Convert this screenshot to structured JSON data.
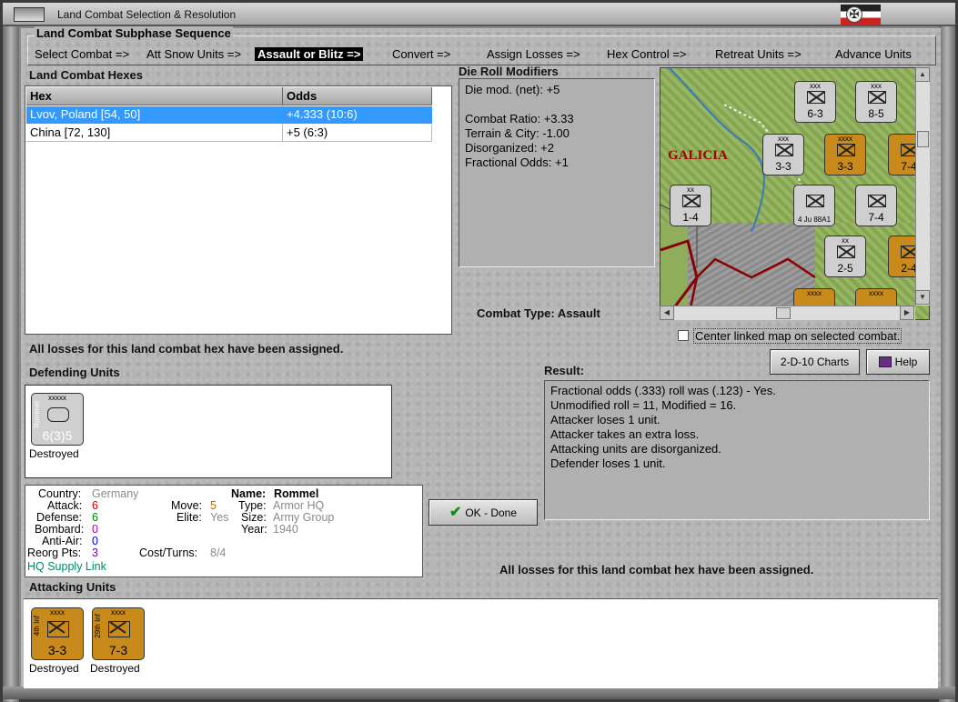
{
  "window": {
    "title": "Land Combat Selection & Resolution"
  },
  "sequence": {
    "title": "Land Combat Subphase Sequence",
    "steps": [
      {
        "label": "Select Combat =>",
        "active": false
      },
      {
        "label": "Att Snow Units =>",
        "active": false
      },
      {
        "label": "Assault or Blitz =>",
        "active": true
      },
      {
        "label": "Convert =>",
        "active": false
      },
      {
        "label": "Assign Losses =>",
        "active": false
      },
      {
        "label": "Hex Control =>",
        "active": false
      },
      {
        "label": "Retreat Units =>",
        "active": false
      },
      {
        "label": "Advance Units",
        "active": false
      }
    ]
  },
  "hexes": {
    "title": "Land Combat Hexes",
    "columns": [
      "Hex",
      "Odds"
    ],
    "rows": [
      {
        "hex": "Lvov, Poland [54, 50]",
        "odds": "+4.333 (10:6)",
        "selected": true
      },
      {
        "hex": "China [72, 130]",
        "odds": "+5 (6:3)",
        "selected": false
      }
    ],
    "losses_note": "All losses for this land combat hex have been assigned."
  },
  "die_roll": {
    "title": "Die Roll Modifiers",
    "lines": [
      "Die mod. (net): +5",
      "",
      "Combat Ratio: +3.33",
      "Terrain & City: -1.00",
      "Disorganized: +2",
      "Fractional Odds: +1"
    ]
  },
  "combat_type": "Combat Type:  Assault",
  "map": {
    "region_label": "GALICIA",
    "counters": [
      {
        "top": "xxx",
        "val": "6-3",
        "color": "grey"
      },
      {
        "top": "xxx",
        "val": "8-5",
        "color": "grey"
      },
      {
        "top": "xxx",
        "val": "3-3",
        "color": "grey"
      },
      {
        "top": "xxxx",
        "val": "3-3",
        "color": "orange"
      },
      {
        "top": "",
        "val": "7-4",
        "color": "orange"
      },
      {
        "top": "xx",
        "val": "1-4",
        "color": "grey"
      },
      {
        "top": "",
        "val": "4 Ju 88A1",
        "color": "grey"
      },
      {
        "top": "",
        "val": "7-4",
        "color": "grey"
      },
      {
        "top": "xx",
        "val": "2-5",
        "color": "grey"
      },
      {
        "top": "",
        "val": "2-4",
        "color": "orange"
      },
      {
        "top": "xxxx",
        "val": "",
        "color": "orange"
      },
      {
        "top": "xxxx",
        "val": "",
        "color": "orange"
      }
    ],
    "center_checkbox_label": "Center linked map on selected combat."
  },
  "buttons": {
    "charts": "2-D-10 Charts",
    "help": "Help",
    "ok": "OK - Done"
  },
  "result": {
    "title": "Result:",
    "lines": [
      "Fractional odds (.333) roll was (.123)  - Yes.",
      "Unmodified roll = 11, Modified = 16.",
      "Attacker loses 1 unit.",
      "Attacker takes an extra loss.",
      "Attacking units are disorganized.",
      "Defender loses 1 unit."
    ],
    "losses_note": "All losses for this land combat hex have been assigned."
  },
  "defending": {
    "title": "Defending Units",
    "units": [
      {
        "top": "xxxxx",
        "side": "Rommel",
        "val": "6(3)5",
        "status": "Destroyed",
        "color": "grey"
      }
    ]
  },
  "unit_info": {
    "country_label": "Country:",
    "country": "Germany",
    "attack_label": "Attack:",
    "attack": "6",
    "defense_label": "Defense:",
    "defense": "6",
    "bombard_label": "Bombard:",
    "bombard": "0",
    "antiair_label": "Anti-Air:",
    "antiair": "0",
    "reorg_label": "Reorg Pts:",
    "reorg": "3",
    "hq_link": "HQ Supply Link",
    "move_label": "Move:",
    "move": "5",
    "elite_label": "Elite:",
    "elite": "Yes",
    "cost_label": "Cost/Turns:",
    "cost": "8/4",
    "name_label": "Name:",
    "name": "Rommel",
    "type_label": "Type:",
    "type": "Armor HQ",
    "size_label": "Size:",
    "size": "Army Group",
    "year_label": "Year:",
    "year": "1940",
    "colors": {
      "attack": "#cc0000",
      "defense": "#008800",
      "bombard": "#aa00aa",
      "antiair": "#0000cc",
      "reorg": "#7a00aa",
      "move": "#b07000",
      "hq": "#00886a"
    }
  },
  "attacking": {
    "title": "Attacking Units",
    "units": [
      {
        "top": "xxxx",
        "side": "4th Inf",
        "val": "3-3",
        "status": "Destroyed",
        "color": "orange"
      },
      {
        "top": "xxxx",
        "side": "29th Inf",
        "val": "7-3",
        "status": "Destroyed",
        "color": "orange"
      }
    ]
  }
}
